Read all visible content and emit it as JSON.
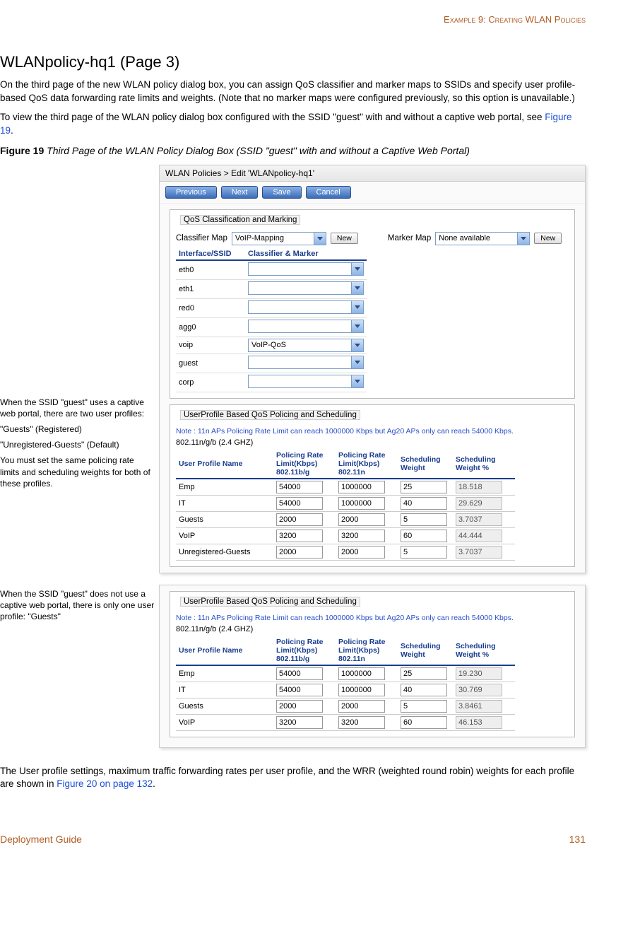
{
  "header_right": "Example 9: Creating WLAN Policies",
  "heading": "WLANpolicy-hq1 (Page 3)",
  "para1": "On the third page of the new WLAN policy dialog box, you can assign QoS classifier and marker maps to SSIDs and specify user profile-based QoS data forwarding rate limits and weights. (Note that no marker maps were configured previously, so this option is unavailable.)",
  "para2a": "To view the third page of the WLAN policy dialog box configured with the SSID \"guest\" with and without a captive web portal, see ",
  "para2b_link": "Figure 19",
  "para2c": ".",
  "fig_label": "Figure 19 ",
  "fig_title": "Third Page of the WLAN Policy Dialog Box (SSID \"guest\" with and without a Captive Web Portal)",
  "side": {
    "n1": "When the SSID \"guest\" uses a captive web portal, there are two user profiles:",
    "n2": "\"Guests\" (Registered)",
    "n3": "\"Unregistered-Guests\" (Default)",
    "n4": "You must set the same policing rate limits and scheduling weights for both of these profiles.",
    "n5": "When the SSID \"guest\" does not use a captive web portal, there is only one user profile: \"Guests\""
  },
  "dialog": {
    "title": "WLAN Policies > Edit 'WLANpolicy-hq1'",
    "buttons": {
      "prev": "Previous",
      "next": "Next",
      "save": "Save",
      "cancel": "Cancel"
    },
    "qos_legend": "QoS Classification and Marking",
    "classifier_label": "Classifier Map",
    "classifier_value": "VoIP-Mapping",
    "marker_label": "Marker Map",
    "marker_value": "None available",
    "new_btn": "New",
    "if_header1": "Interface/SSID",
    "if_header2": "Classifier & Marker",
    "interfaces": [
      {
        "name": "eth0",
        "val": ""
      },
      {
        "name": "eth1",
        "val": ""
      },
      {
        "name": "red0",
        "val": ""
      },
      {
        "name": "agg0",
        "val": ""
      },
      {
        "name": "voip",
        "val": "VoIP-QoS"
      },
      {
        "name": "guest",
        "val": ""
      },
      {
        "name": "corp",
        "val": ""
      }
    ],
    "up_legend": "UserProfile Based QoS Policing and Scheduling",
    "note": "Note : 11n APs Policing Rate Limit can reach 1000000 Kbps but Ag20 APs only can reach 54000 Kbps.",
    "band": "802.11n/g/b (2.4 GHZ)",
    "cols": {
      "c1": "User Profile Name",
      "c2": "Policing Rate Limit(Kbps) 802.11b/g",
      "c3": "Policing Rate Limit(Kbps) 802.11n",
      "c4": "Scheduling Weight",
      "c5": "Scheduling Weight %"
    },
    "rows1": [
      {
        "name": "Emp",
        "bg": "54000",
        "n": "1000000",
        "w": "25",
        "p": "18.518"
      },
      {
        "name": "IT",
        "bg": "54000",
        "n": "1000000",
        "w": "40",
        "p": "29.629"
      },
      {
        "name": "Guests",
        "bg": "2000",
        "n": "2000",
        "w": "5",
        "p": "3.7037"
      },
      {
        "name": "VoIP",
        "bg": "3200",
        "n": "3200",
        "w": "60",
        "p": "44.444"
      },
      {
        "name": "Unregistered-Guests",
        "bg": "2000",
        "n": "2000",
        "w": "5",
        "p": "3.7037"
      }
    ],
    "rows2": [
      {
        "name": "Emp",
        "bg": "54000",
        "n": "1000000",
        "w": "25",
        "p": "19.230"
      },
      {
        "name": "IT",
        "bg": "54000",
        "n": "1000000",
        "w": "40",
        "p": "30.769"
      },
      {
        "name": "Guests",
        "bg": "2000",
        "n": "2000",
        "w": "5",
        "p": "3.8461"
      },
      {
        "name": "VoIP",
        "bg": "3200",
        "n": "3200",
        "w": "60",
        "p": "46.153"
      }
    ]
  },
  "para3a": "The User profile settings, maximum traffic forwarding rates per user profile, and the WRR (weighted round robin) weights for each profile are shown in ",
  "para3b_link": "Figure 20 on page 132",
  "para3c": ".",
  "footer_left": "Deployment Guide",
  "footer_right": "131"
}
